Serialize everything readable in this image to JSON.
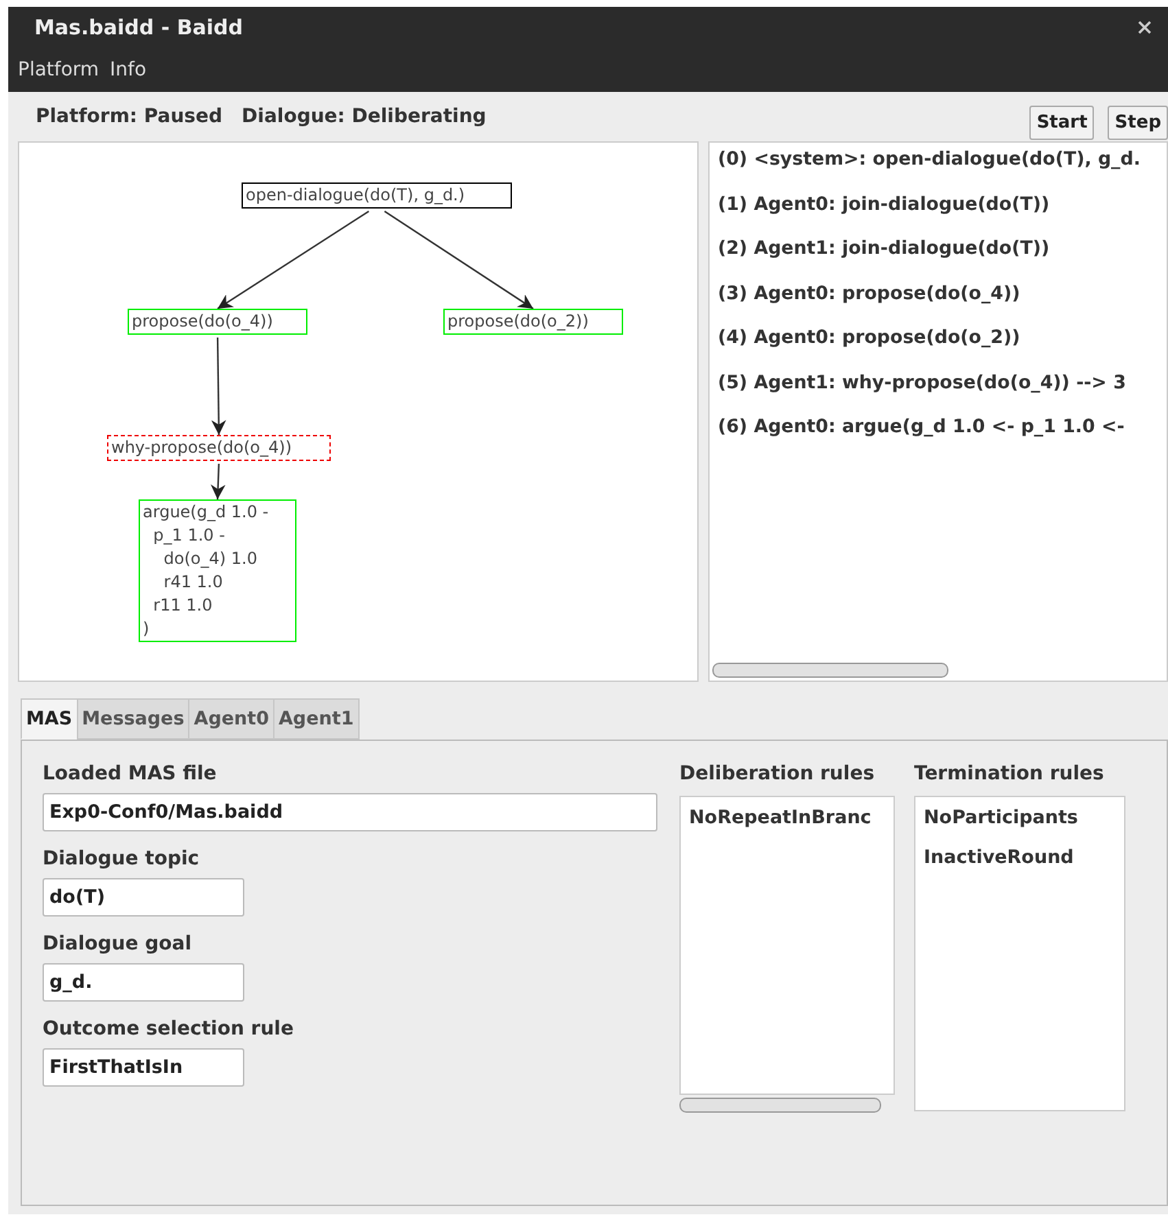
{
  "window": {
    "title": "Mas.baidd - Baidd"
  },
  "menu": [
    "Platform",
    "Info"
  ],
  "status": {
    "platform": "Platform: Paused",
    "dialogue": "Dialogue: Deliberating"
  },
  "buttons": [
    "Start",
    "Step"
  ],
  "graph": {
    "root": {
      "lines": [
        "open-dialogue(do(T), g_d.)"
      ],
      "color": "#000000",
      "dashed": false,
      "children": [
        {
          "lines": [
            "propose(do(o_4))"
          ],
          "color": "#00ee00",
          "dashed": false,
          "children": [
            {
              "lines": [
                "why-propose(do(o_4))"
              ],
              "color": "#ee0000",
              "dashed": true,
              "children": [
                {
                  "lines": [
                    "argue(g_d 1.0 -",
                    "  p_1 1.0 -",
                    "    do(o_4) 1.0",
                    "    r41 1.0",
                    "  r11 1.0",
                    ")"
                  ],
                  "color": "#00ee00",
                  "dashed": false
                }
              ]
            }
          ]
        },
        {
          "lines": [
            "propose(do(o_2))"
          ],
          "color": "#00ee00",
          "dashed": false
        }
      ]
    }
  },
  "messages": [
    "(0) <system>: open-dialogue(do(T), g_d.",
    "(1) Agent0: join-dialogue(do(T))",
    "(2) Agent1: join-dialogue(do(T))",
    "(3) Agent0: propose(do(o_4))",
    "(4) Agent0: propose(do(o_2))",
    "(5) Agent1: why-propose(do(o_4)) --> 3",
    "(6) Agent0: argue(g_d 1.0 <-  p_1 1.0 <-"
  ],
  "tabs": [
    {
      "label": "MAS",
      "selected": true
    },
    {
      "label": "Messages",
      "selected": false
    },
    {
      "label": "Agent0",
      "selected": false
    },
    {
      "label": "Agent1",
      "selected": false
    }
  ],
  "fields": [
    {
      "label": "Loaded MAS file",
      "value": "Exp0-Conf0/Mas.baidd",
      "kind": "wide"
    },
    {
      "label": "Dialogue topic",
      "value": "do(T)",
      "kind": "short"
    },
    {
      "label": "Dialogue goal",
      "value": "g_d.",
      "kind": "short"
    },
    {
      "label": "Outcome selection rule",
      "value": "FirstThatIsIn",
      "kind": "short"
    }
  ],
  "deliberation_rules": {
    "label": "Deliberation rules",
    "items": [
      "NoRepeatInBranc"
    ]
  },
  "termination_rules": {
    "label": "Termination rules",
    "items": [
      "NoParticipants",
      "InactiveRound"
    ]
  }
}
